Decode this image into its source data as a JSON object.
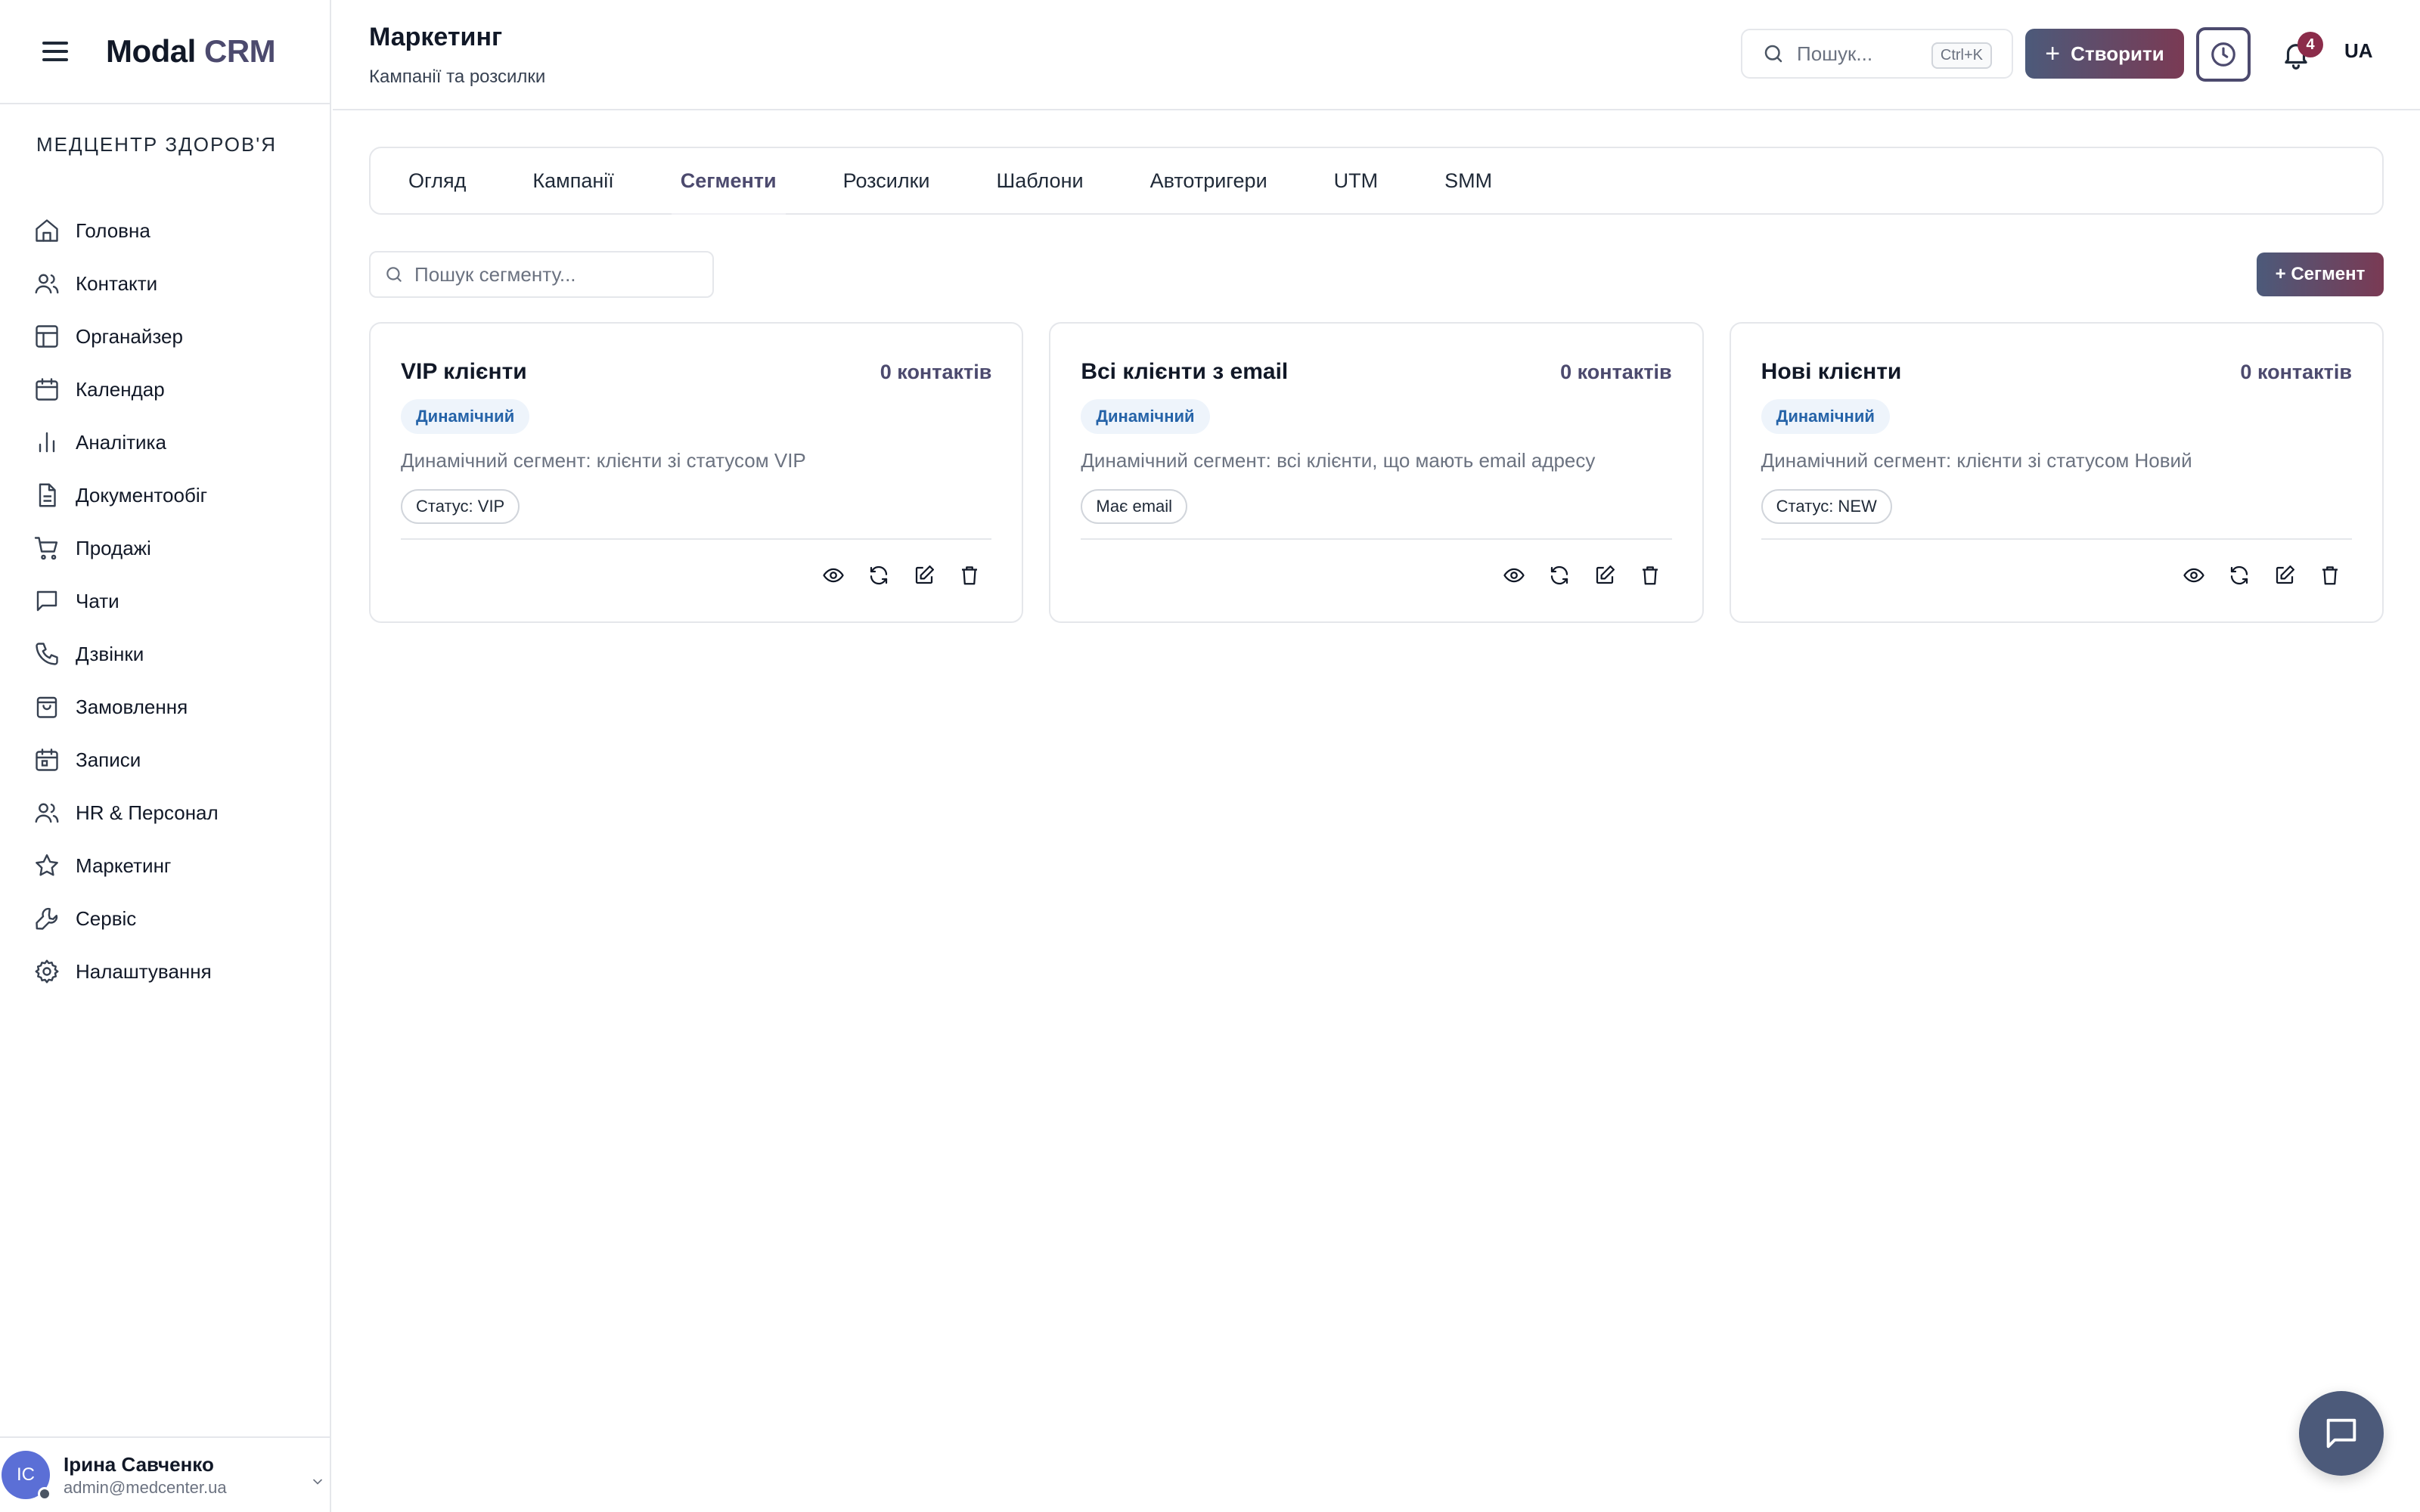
{
  "brand": {
    "name": "Modal",
    "accent": "CRM"
  },
  "org": {
    "name": "МЕДЦЕНТР ЗДОРОВ'Я"
  },
  "sidebar": {
    "items": [
      {
        "label": "Головна",
        "icon": "home-icon"
      },
      {
        "label": "Контакти",
        "icon": "users-icon"
      },
      {
        "label": "Органайзер",
        "icon": "layout-icon"
      },
      {
        "label": "Календар",
        "icon": "calendar-icon"
      },
      {
        "label": "Аналітика",
        "icon": "bar-chart-icon"
      },
      {
        "label": "Документообіг",
        "icon": "document-icon"
      },
      {
        "label": "Продажі",
        "icon": "cart-icon"
      },
      {
        "label": "Чати",
        "icon": "chat-icon"
      },
      {
        "label": "Дзвінки",
        "icon": "phone-icon"
      },
      {
        "label": "Замовлення",
        "icon": "shopping-bag-icon"
      },
      {
        "label": "Записи",
        "icon": "calendar-check-icon"
      },
      {
        "label": "HR & Персонал",
        "icon": "users-icon"
      },
      {
        "label": "Маркетинг",
        "icon": "star-icon"
      },
      {
        "label": "Сервіс",
        "icon": "wrench-icon"
      },
      {
        "label": "Налаштування",
        "icon": "gear-icon"
      }
    ]
  },
  "user": {
    "initials": "IC",
    "name": "Ірина Савченко",
    "email": "admin@medcenter.ua"
  },
  "header": {
    "title": "Маркетинг",
    "subtitle": "Кампанії та розсилки",
    "search_placeholder": "Пошук...",
    "search_shortcut": "Ctrl+K",
    "create_label": "Створити",
    "notifications_count": "4",
    "language": "UA"
  },
  "tabs": [
    {
      "label": "Огляд",
      "active": false
    },
    {
      "label": "Кампанії",
      "active": false
    },
    {
      "label": "Сегменти",
      "active": true
    },
    {
      "label": "Розсилки",
      "active": false
    },
    {
      "label": "Шаблони",
      "active": false
    },
    {
      "label": "Автотригери",
      "active": false
    },
    {
      "label": "UTM",
      "active": false
    },
    {
      "label": "SMM",
      "active": false
    }
  ],
  "segments": {
    "search_placeholder": "Пошук сегменту...",
    "add_label": "+ Сегмент",
    "cards": [
      {
        "title": "VIP клієнти",
        "count": "0 контактів",
        "type": "Динамічний",
        "description": "Динамічний сегмент: клієнти зі статусом VIP",
        "filter": "Статус: VIP"
      },
      {
        "title": "Всі клієнти з email",
        "count": "0 контактів",
        "type": "Динамічний",
        "description": "Динамічний сегмент: всі клієнти, що мають email адресу",
        "filter": "Має email"
      },
      {
        "title": "Нові клієнти",
        "count": "0 контактів",
        "type": "Динамічний",
        "description": "Динамічний сегмент: клієнти зі статусом Новий",
        "filter": "Статус: NEW"
      }
    ]
  },
  "colors": {
    "accent": "#4c4a6e",
    "gradient_start": "#4c5a7a",
    "gradient_end": "#7a3a54",
    "badge": "#8b2c4a",
    "type_tag": "#2563a8"
  }
}
